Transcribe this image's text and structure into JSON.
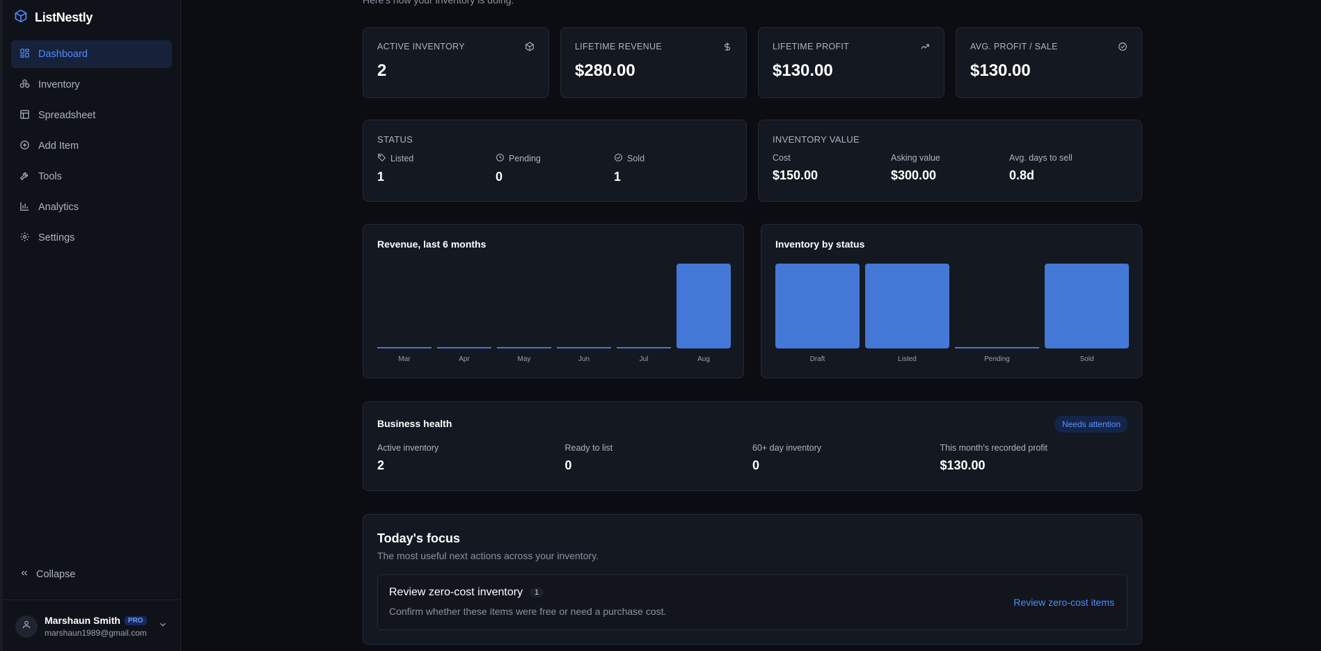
{
  "app": {
    "name": "ListNestly"
  },
  "nav": [
    {
      "label": "Dashboard",
      "icon": "grid-icon",
      "active": true
    },
    {
      "label": "Inventory",
      "icon": "boxes-icon"
    },
    {
      "label": "Spreadsheet",
      "icon": "table-icon"
    },
    {
      "label": "Add Item",
      "icon": "plus-circle-icon"
    },
    {
      "label": "Tools",
      "icon": "wrench-icon"
    },
    {
      "label": "Analytics",
      "icon": "bar-chart-icon"
    },
    {
      "label": "Settings",
      "icon": "gear-icon"
    }
  ],
  "sidebar": {
    "collapse_label": "Collapse"
  },
  "user": {
    "name": "Marshaun Smith",
    "plan": "PRO",
    "email": "marshaun1989@gmail.com"
  },
  "header": {
    "subtitle": "Here's how your inventory is doing."
  },
  "stats": [
    {
      "label": "ACTIVE INVENTORY",
      "value": "2",
      "icon": "box-icon"
    },
    {
      "label": "LIFETIME REVENUE",
      "value": "$280.00",
      "icon": "dollar-icon"
    },
    {
      "label": "LIFETIME PROFIT",
      "value": "$130.00",
      "icon": "trending-up-icon"
    },
    {
      "label": "AVG. PROFIT / SALE",
      "value": "$130.00",
      "icon": "check-circle-icon"
    }
  ],
  "status": {
    "title": "STATUS",
    "items": [
      {
        "label": "Listed",
        "value": "1",
        "icon": "tag-icon"
      },
      {
        "label": "Pending",
        "value": "0",
        "icon": "clock-icon"
      },
      {
        "label": "Sold",
        "value": "1",
        "icon": "check-circle-icon"
      }
    ]
  },
  "inventory_value": {
    "title": "INVENTORY VALUE",
    "items": [
      {
        "label": "Cost",
        "value": "$150.00"
      },
      {
        "label": "Asking value",
        "value": "$300.00"
      },
      {
        "label": "Avg. days to sell",
        "value": "0.8d"
      }
    ]
  },
  "chart_data": [
    {
      "type": "bar",
      "title": "Revenue, last 6 months",
      "categories": [
        "Mar",
        "Apr",
        "May",
        "Jun",
        "Jul",
        "Aug"
      ],
      "values": [
        0,
        0,
        0,
        0,
        0,
        280
      ],
      "color": "#4478d6"
    },
    {
      "type": "bar",
      "title": "Inventory by status",
      "categories": [
        "Draft",
        "Listed",
        "Pending",
        "Sold"
      ],
      "values": [
        1,
        1,
        0,
        1
      ],
      "color": "#4478d6"
    }
  ],
  "health": {
    "title": "Business health",
    "badge": "Needs attention",
    "items": [
      {
        "label": "Active inventory",
        "value": "2"
      },
      {
        "label": "Ready to list",
        "value": "0"
      },
      {
        "label": "60+ day inventory",
        "value": "0"
      },
      {
        "label": "This month's recorded profit",
        "value": "$130.00"
      }
    ]
  },
  "focus": {
    "title": "Today's focus",
    "subtitle": "The most useful next actions across your inventory.",
    "task": {
      "title": "Review zero-cost inventory",
      "count": "1",
      "description": "Confirm whether these items were free or need a purchase cost.",
      "action": "Review zero-cost items"
    }
  }
}
